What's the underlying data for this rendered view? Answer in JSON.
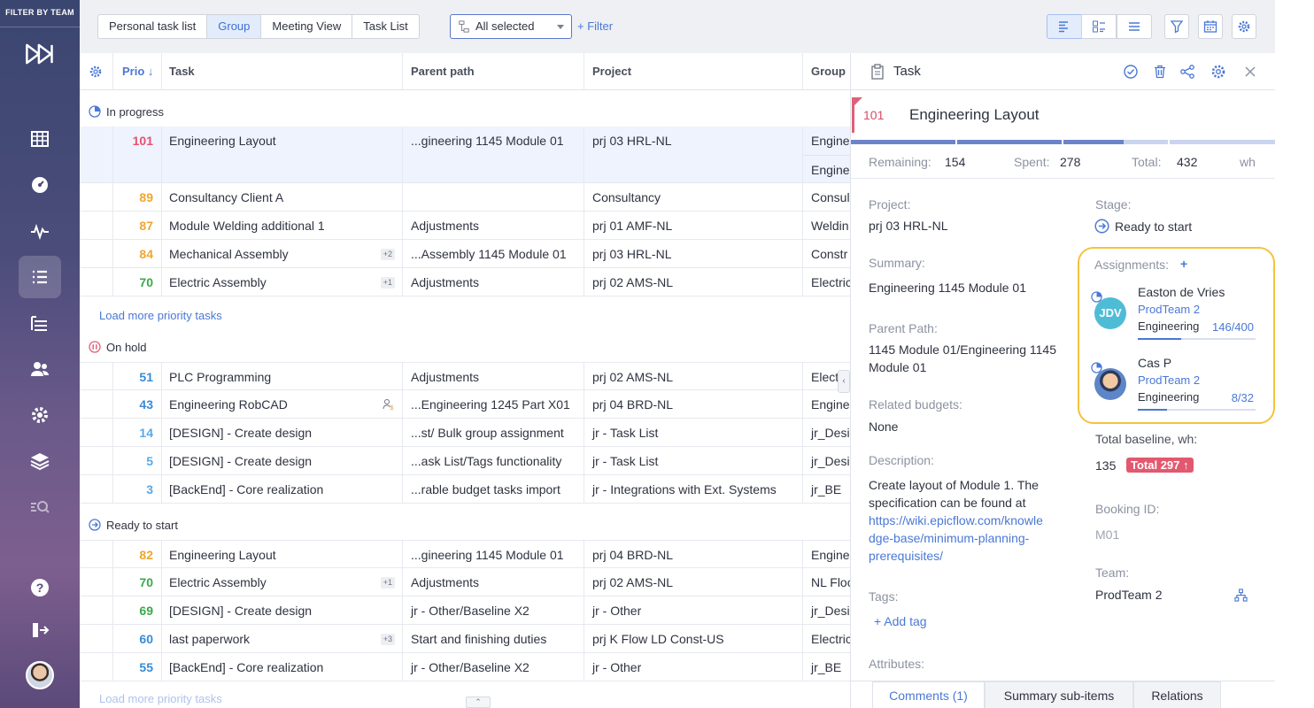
{
  "sidebar": {
    "filter_title": "FILTER BY TEAM"
  },
  "toolbar": {
    "views": [
      "Personal task list",
      "Group",
      "Meeting View",
      "Task List"
    ],
    "active_view": "Group",
    "dropdown_value": "All selected",
    "filter_label": "+ Filter"
  },
  "table": {
    "headers": {
      "prio": "Prio ↓",
      "task": "Task",
      "parent": "Parent path",
      "project": "Project",
      "group": "Group"
    },
    "groups": [
      {
        "name": "In progress",
        "rows": [
          {
            "prio": "101",
            "prio_color": "#e8516f",
            "task": "Engineering Layout",
            "badge": "",
            "parent": "...gineering 1145 Module 01",
            "project": "prj 03 HRL-NL",
            "group": "Engine",
            "group2": "Engine"
          },
          {
            "prio": "89",
            "prio_color": "#f0a62f",
            "task": "Consultancy Client A",
            "badge": "",
            "parent": "",
            "project": "Consultancy",
            "group": "Consul"
          },
          {
            "prio": "87",
            "prio_color": "#f0a62f",
            "task": "Module Welding additional 1",
            "badge": "",
            "parent": "Adjustments",
            "project": "prj 01 AMF-NL",
            "group": "Weldin"
          },
          {
            "prio": "84",
            "prio_color": "#f0a62f",
            "task": "Mechanical Assembly",
            "badge": "+2",
            "parent": "...Assembly 1145 Module 01",
            "project": "prj 03 HRL-NL",
            "group": "Constr"
          },
          {
            "prio": "70",
            "prio_color": "#3aa94a",
            "task": "Electric Assembly",
            "badge": "+1",
            "parent": "Adjustments",
            "project": "prj 02 AMS-NL",
            "group": "Electric"
          }
        ],
        "load_more": "Load more priority tasks"
      },
      {
        "name": "On hold",
        "rows": [
          {
            "prio": "51",
            "prio_color": "#3a8bd6",
            "task": "PLC Programming",
            "badge": "",
            "parent": "Adjustments",
            "project": "prj 02 AMS-NL",
            "group": "Electr"
          },
          {
            "prio": "43",
            "prio_color": "#3a8bd6",
            "task": "Engineering RobCAD",
            "badge": "",
            "parent": "...Engineering 1245 Part X01",
            "project": "prj 04 BRD-NL",
            "group": "Engine"
          },
          {
            "prio": "14",
            "prio_color": "#5aa9e6",
            "task": "[DESIGN] - Create design",
            "badge": "",
            "parent": "...st/ Bulk group assignment",
            "project": "jr - Task List",
            "group": "jr_Desi"
          },
          {
            "prio": "5",
            "prio_color": "#5aa9e6",
            "task": "[DESIGN] - Create design",
            "badge": "",
            "parent": "...ask List/Tags functionality",
            "project": "jr - Task List",
            "group": "jr_Desi"
          },
          {
            "prio": "3",
            "prio_color": "#5aa9e6",
            "task": "[BackEnd] - Core realization",
            "badge": "",
            "parent": "...rable budget tasks import",
            "project": "jr - Integrations with Ext. Systems",
            "group": "jr_BE"
          }
        ]
      },
      {
        "name": "Ready to start",
        "rows": [
          {
            "prio": "82",
            "prio_color": "#f0a62f",
            "task": "Engineering Layout",
            "badge": "",
            "parent": "...gineering 1145 Module 01",
            "project": "prj 04 BRD-NL",
            "group": "Engine"
          },
          {
            "prio": "70",
            "prio_color": "#3aa94a",
            "task": "Electric Assembly",
            "badge": "+1",
            "parent": "Adjustments",
            "project": "prj 02 AMS-NL",
            "group": "NL Floo"
          },
          {
            "prio": "69",
            "prio_color": "#3aa94a",
            "task": "[DESIGN] - Create design",
            "badge": "",
            "parent": "jr - Other/Baseline X2",
            "project": "jr - Other",
            "group": "jr_Desi"
          },
          {
            "prio": "60",
            "prio_color": "#3a8bd6",
            "task": "last paperwork",
            "badge": "+3",
            "parent": "Start and finishing duties",
            "project": "prj K Flow LD Const-US",
            "group": "Electric"
          },
          {
            "prio": "55",
            "prio_color": "#3a8bd6",
            "task": "[BackEnd] - Core realization",
            "badge": "",
            "parent": "jr - Other/Baseline X2",
            "project": "jr - Other",
            "group": "jr_BE"
          }
        ],
        "load_more": "Load more priority tasks"
      }
    ]
  },
  "panel": {
    "header_title": "Task",
    "task_number": "101",
    "task_title": "Engineering Layout",
    "remaining_label": "Remaining:",
    "remaining_value": "154",
    "spent_label": "Spent:",
    "spent_value": "278",
    "total_label": "Total:",
    "total_value": "432",
    "unit": "wh",
    "project_label": "Project:",
    "project_value": "prj 03 HRL-NL",
    "stage_label": "Stage:",
    "stage_value": "Ready to start",
    "summary_label": "Summary:",
    "summary_value": "Engineering 1145 Module 01",
    "assignments_label": "Assignments:",
    "assignments_add": "+",
    "assignees": [
      {
        "initials": "JDV",
        "name": "Easton de Vries",
        "team": "ProdTeam 2",
        "dept": "Engineering",
        "ratio": "146/400",
        "fill": 0.365
      },
      {
        "initials": "",
        "name": "Cas P",
        "team": "ProdTeam 2",
        "dept": "Engineering",
        "ratio": "8/32",
        "fill": 0.25
      }
    ],
    "parent_path_label": "Parent Path:",
    "parent_path_line1": "1145 Module 01/Engineering 1145",
    "parent_path_line2": "Module 01",
    "related_budgets_label": "Related budgets:",
    "related_budgets_value": "None",
    "total_baseline_label": "Total baseline, wh:",
    "total_baseline_value": "135",
    "total_badge": "Total 297 ↑",
    "description_label": "Description:",
    "description_line1": "Create layout of Module 1. The",
    "description_line2": "specification can be found at",
    "description_link1": "https://wiki.epicflow.com/knowle",
    "description_link2": "dge-base/minimum-planning-",
    "description_link3": "prerequisites/",
    "booking_label": "Booking ID:",
    "booking_value": "M01",
    "team_label": "Team:",
    "team_value": "ProdTeam 2",
    "tags_label": "Tags:",
    "add_tag": "+ Add tag",
    "attributes_label": "Attributes:",
    "tabs": [
      "Comments (1)",
      "Summary sub-items",
      "Relations"
    ],
    "active_tab": "Comments (1)"
  }
}
